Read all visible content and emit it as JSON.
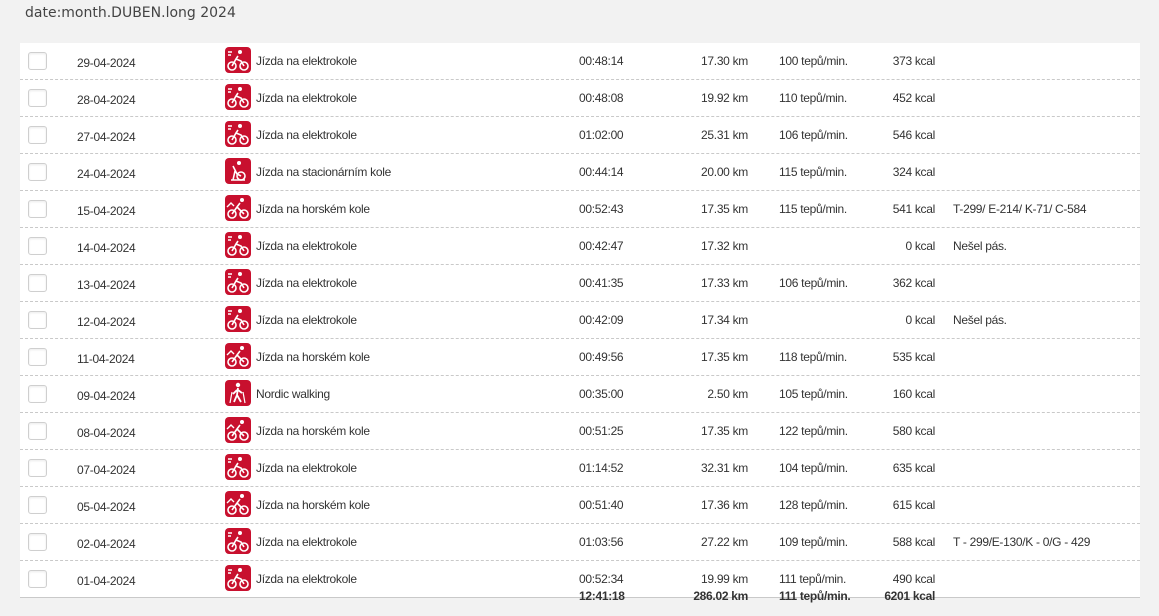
{
  "header": {
    "title": "date:month.DUBEN.long 2024"
  },
  "rows": [
    {
      "date": "29-04-2024",
      "icon": "ebike-icon",
      "activity": "Jízda na elektrokole",
      "duration": "00:48:14",
      "distance": "17.30 km",
      "hr": "100 tepů/min.",
      "kcal": "373 kcal",
      "note": ""
    },
    {
      "date": "28-04-2024",
      "icon": "ebike-icon",
      "activity": "Jízda na elektrokole",
      "duration": "00:48:08",
      "distance": "19.92 km",
      "hr": "110 tepů/min.",
      "kcal": "452 kcal",
      "note": ""
    },
    {
      "date": "27-04-2024",
      "icon": "ebike-icon",
      "activity": "Jízda na elektrokole",
      "duration": "01:02:00",
      "distance": "25.31 km",
      "hr": "106 tepů/min.",
      "kcal": "546 kcal",
      "note": ""
    },
    {
      "date": "24-04-2024",
      "icon": "stationary-bike-icon",
      "activity": "Jízda na stacionárním kole",
      "duration": "00:44:14",
      "distance": "20.00 km",
      "hr": "115 tepů/min.",
      "kcal": "324 kcal",
      "note": ""
    },
    {
      "date": "15-04-2024",
      "icon": "mountain-bike-icon",
      "activity": "Jízda na horském kole",
      "duration": "00:52:43",
      "distance": "17.35 km",
      "hr": "115 tepů/min.",
      "kcal": "541 kcal",
      "note": "T-299/ E-214/ K-71/ C-584"
    },
    {
      "date": "14-04-2024",
      "icon": "ebike-icon",
      "activity": "Jízda na elektrokole",
      "duration": "00:42:47",
      "distance": "17.32 km",
      "hr": "",
      "kcal": "0 kcal",
      "note": "Nešel pás."
    },
    {
      "date": "13-04-2024",
      "icon": "ebike-icon",
      "activity": "Jízda na elektrokole",
      "duration": "00:41:35",
      "distance": "17.33 km",
      "hr": "106 tepů/min.",
      "kcal": "362 kcal",
      "note": ""
    },
    {
      "date": "12-04-2024",
      "icon": "ebike-icon",
      "activity": "Jízda na elektrokole",
      "duration": "00:42:09",
      "distance": "17.34 km",
      "hr": "",
      "kcal": "0 kcal",
      "note": "Nešel pás."
    },
    {
      "date": "11-04-2024",
      "icon": "mountain-bike-icon",
      "activity": "Jízda na horském kole",
      "duration": "00:49:56",
      "distance": "17.35 km",
      "hr": "118 tepů/min.",
      "kcal": "535 kcal",
      "note": ""
    },
    {
      "date": "09-04-2024",
      "icon": "nordic-walking-icon",
      "activity": "Nordic walking",
      "duration": "00:35:00",
      "distance": "2.50 km",
      "hr": "105 tepů/min.",
      "kcal": "160 kcal",
      "note": ""
    },
    {
      "date": "08-04-2024",
      "icon": "mountain-bike-icon",
      "activity": "Jízda na horském kole",
      "duration": "00:51:25",
      "distance": "17.35 km",
      "hr": "122 tepů/min.",
      "kcal": "580 kcal",
      "note": ""
    },
    {
      "date": "07-04-2024",
      "icon": "ebike-icon",
      "activity": "Jízda na elektrokole",
      "duration": "01:14:52",
      "distance": "32.31 km",
      "hr": "104 tepů/min.",
      "kcal": "635 kcal",
      "note": ""
    },
    {
      "date": "05-04-2024",
      "icon": "mountain-bike-icon",
      "activity": "Jízda na horském kole",
      "duration": "00:51:40",
      "distance": "17.36 km",
      "hr": "128 tepů/min.",
      "kcal": "615 kcal",
      "note": ""
    },
    {
      "date": "02-04-2024",
      "icon": "ebike-icon",
      "activity": "Jízda na elektrokole",
      "duration": "01:03:56",
      "distance": "27.22 km",
      "hr": "109 tepů/min.",
      "kcal": "588 kcal",
      "note": "T - 299/E-130/K - 0/G - 429"
    },
    {
      "date": "01-04-2024",
      "icon": "ebike-icon",
      "activity": "Jízda na elektrokole",
      "duration": "00:52:34",
      "distance": "19.99 km",
      "hr": "111 tepů/min.",
      "kcal": "490 kcal",
      "note": ""
    }
  ],
  "totals": {
    "duration": "12:41:18",
    "distance": "286.02 km",
    "hr": "111 tepů/min.",
    "kcal": "6201 kcal"
  },
  "colors": {
    "icon_bg": "#c8102e",
    "page_bg": "#f2f2f2",
    "table_bg": "#ffffff"
  }
}
